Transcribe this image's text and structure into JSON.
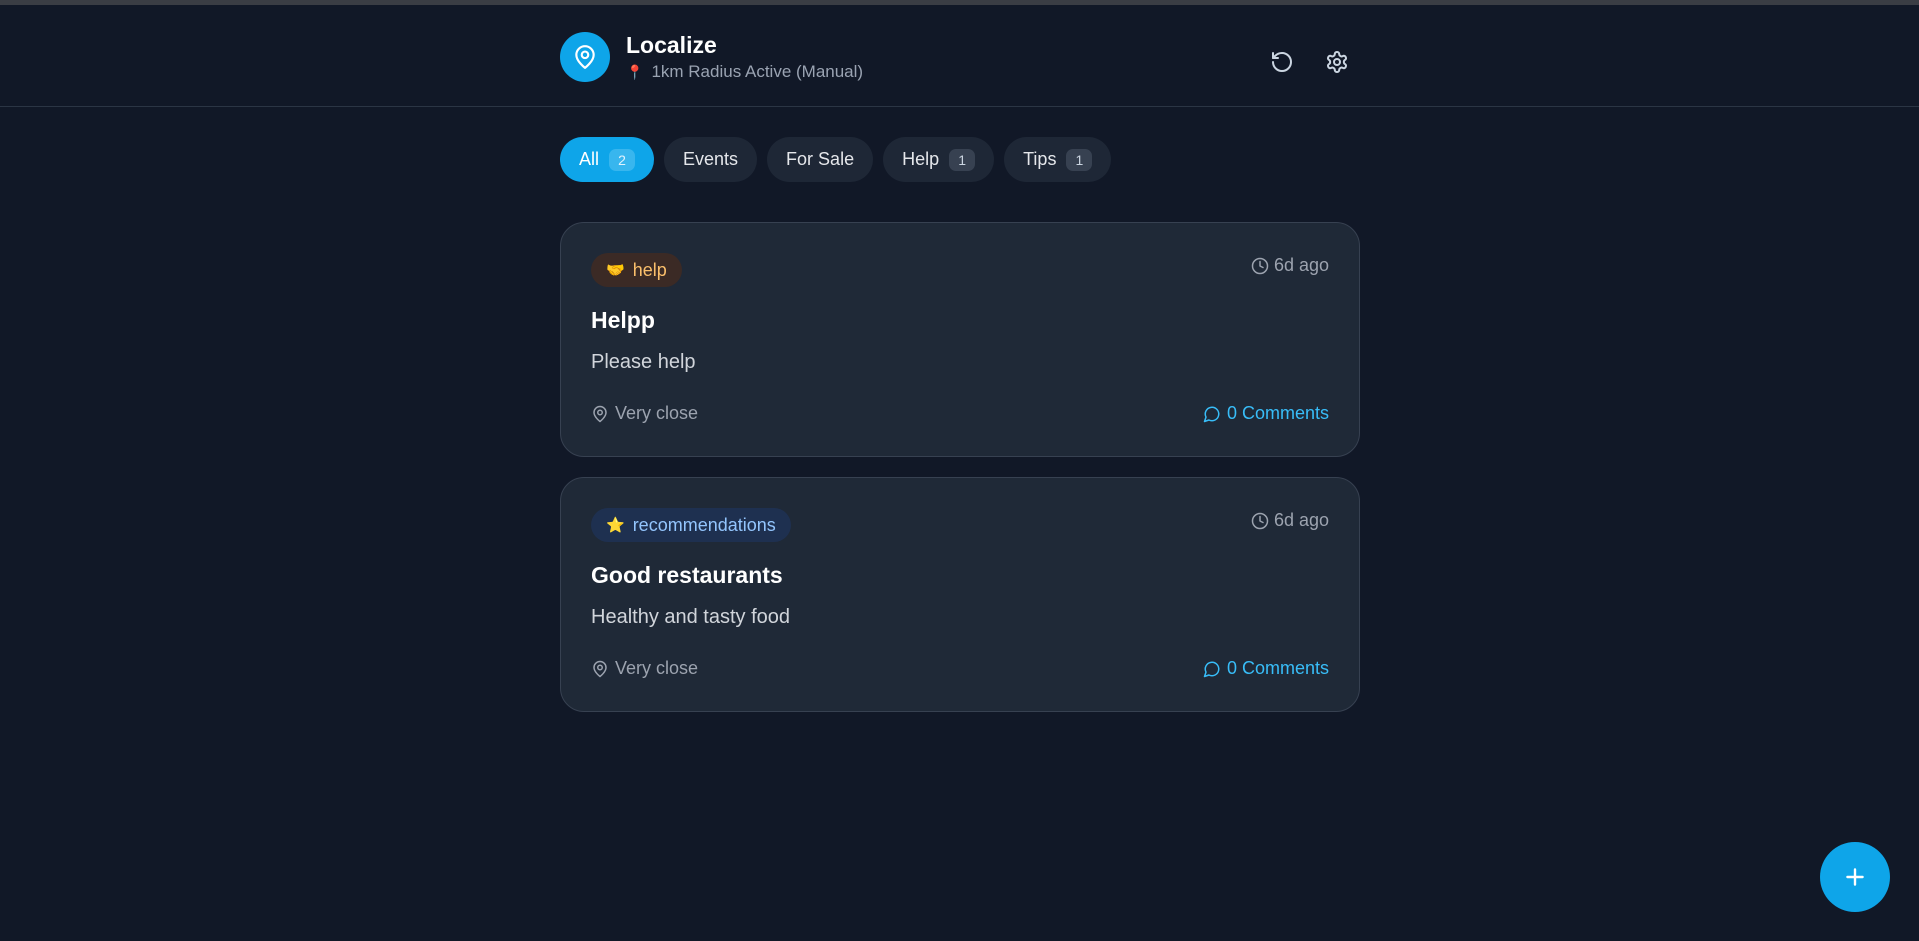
{
  "app": {
    "title": "Localize",
    "subtitle_emoji": "📍",
    "subtitle": "1km Radius Active (Manual)"
  },
  "header_icons": [
    "refresh-icon",
    "gear-icon"
  ],
  "filters": [
    {
      "label": "All",
      "count": "2",
      "active": true
    },
    {
      "label": "Events",
      "count": null,
      "active": false
    },
    {
      "label": "For Sale",
      "count": null,
      "active": false
    },
    {
      "label": "Help",
      "count": "1",
      "active": false
    },
    {
      "label": "Tips",
      "count": "1",
      "active": false
    }
  ],
  "posts": [
    {
      "tag_emoji": "🤝",
      "tag": "help",
      "time": "6d ago",
      "title": "Helpp",
      "body": "Please help",
      "distance": "Very close",
      "comments": "0 Comments"
    },
    {
      "tag_emoji": "⭐",
      "tag": "recommendations",
      "time": "6d ago",
      "title": "Good restaurants",
      "body": "Healthy and tasty food",
      "distance": "Very close",
      "comments": "0 Comments"
    }
  ],
  "fab": {
    "icon": "plus-icon"
  },
  "colors": {
    "accent": "#0ea5e9",
    "background": "#111827",
    "card": "#1f2937",
    "link": "#38bdf8"
  }
}
